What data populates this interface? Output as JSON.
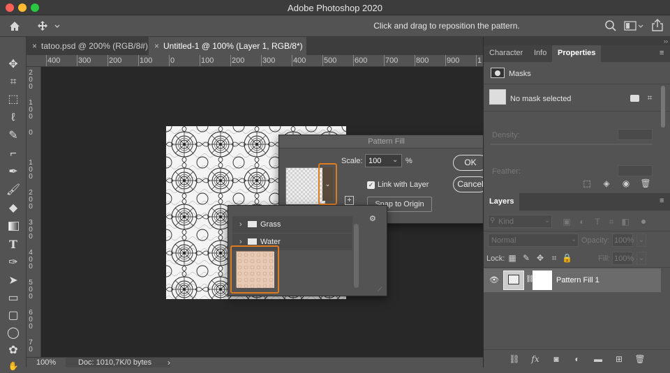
{
  "window": {
    "title": "Adobe Photoshop 2020"
  },
  "options_bar": {
    "hint": "Click and drag to reposition the pattern."
  },
  "tabs": [
    {
      "label": "tatoo.psd @ 200% (RGB/8#)"
    },
    {
      "label": "Untitled-1 @ 100% (Layer 1, RGB/8*)"
    }
  ],
  "ruler": {
    "top": [
      "400",
      "300",
      "200",
      "100",
      "0",
      "100",
      "200",
      "300",
      "400",
      "500",
      "600",
      "700",
      "800",
      "900",
      "1"
    ],
    "left": [
      "2\n0\n0",
      "1\n0\n0",
      "0",
      "1\n0\n0",
      "2\n0\n0",
      "3\n0\n0",
      "4\n0\n0",
      "5\n0\n0",
      "6\n0\n0",
      "7\n0"
    ]
  },
  "status": {
    "zoom": "100%",
    "doc": "Doc: 1010,7K/0 bytes",
    "arrow": "›"
  },
  "pattern_fill": {
    "title": "Pattern Fill",
    "scale_label": "Scale:",
    "scale_value": "100",
    "scale_unit": "%",
    "link_label": "Link with Layer",
    "snap_label": "Snap to Origin",
    "ok": "OK",
    "cancel": "Cancel"
  },
  "pattern_picker": {
    "folders": [
      {
        "label": "Grass"
      },
      {
        "label": "Water"
      }
    ]
  },
  "properties_panel": {
    "tabs": [
      {
        "label": "Character"
      },
      {
        "label": "Info"
      },
      {
        "label": "Properties"
      }
    ],
    "masks_label": "Masks",
    "no_mask": "No mask selected",
    "density_label": "Density:",
    "feather_label": "Feather:"
  },
  "layers_panel": {
    "tab": "Layers",
    "filter": "Kind",
    "blend_mode": "Normal",
    "opacity_label": "Opacity:",
    "opacity_value": "100%",
    "lock_label": "Lock:",
    "fill_label": "Fill:",
    "fill_value": "100%",
    "layer_name": "Pattern Fill 1"
  },
  "colors": {
    "accent_orange": "#e07a1f",
    "traffic_red": "#fe5f57",
    "traffic_yellow": "#febc2e",
    "traffic_green": "#28c840"
  }
}
